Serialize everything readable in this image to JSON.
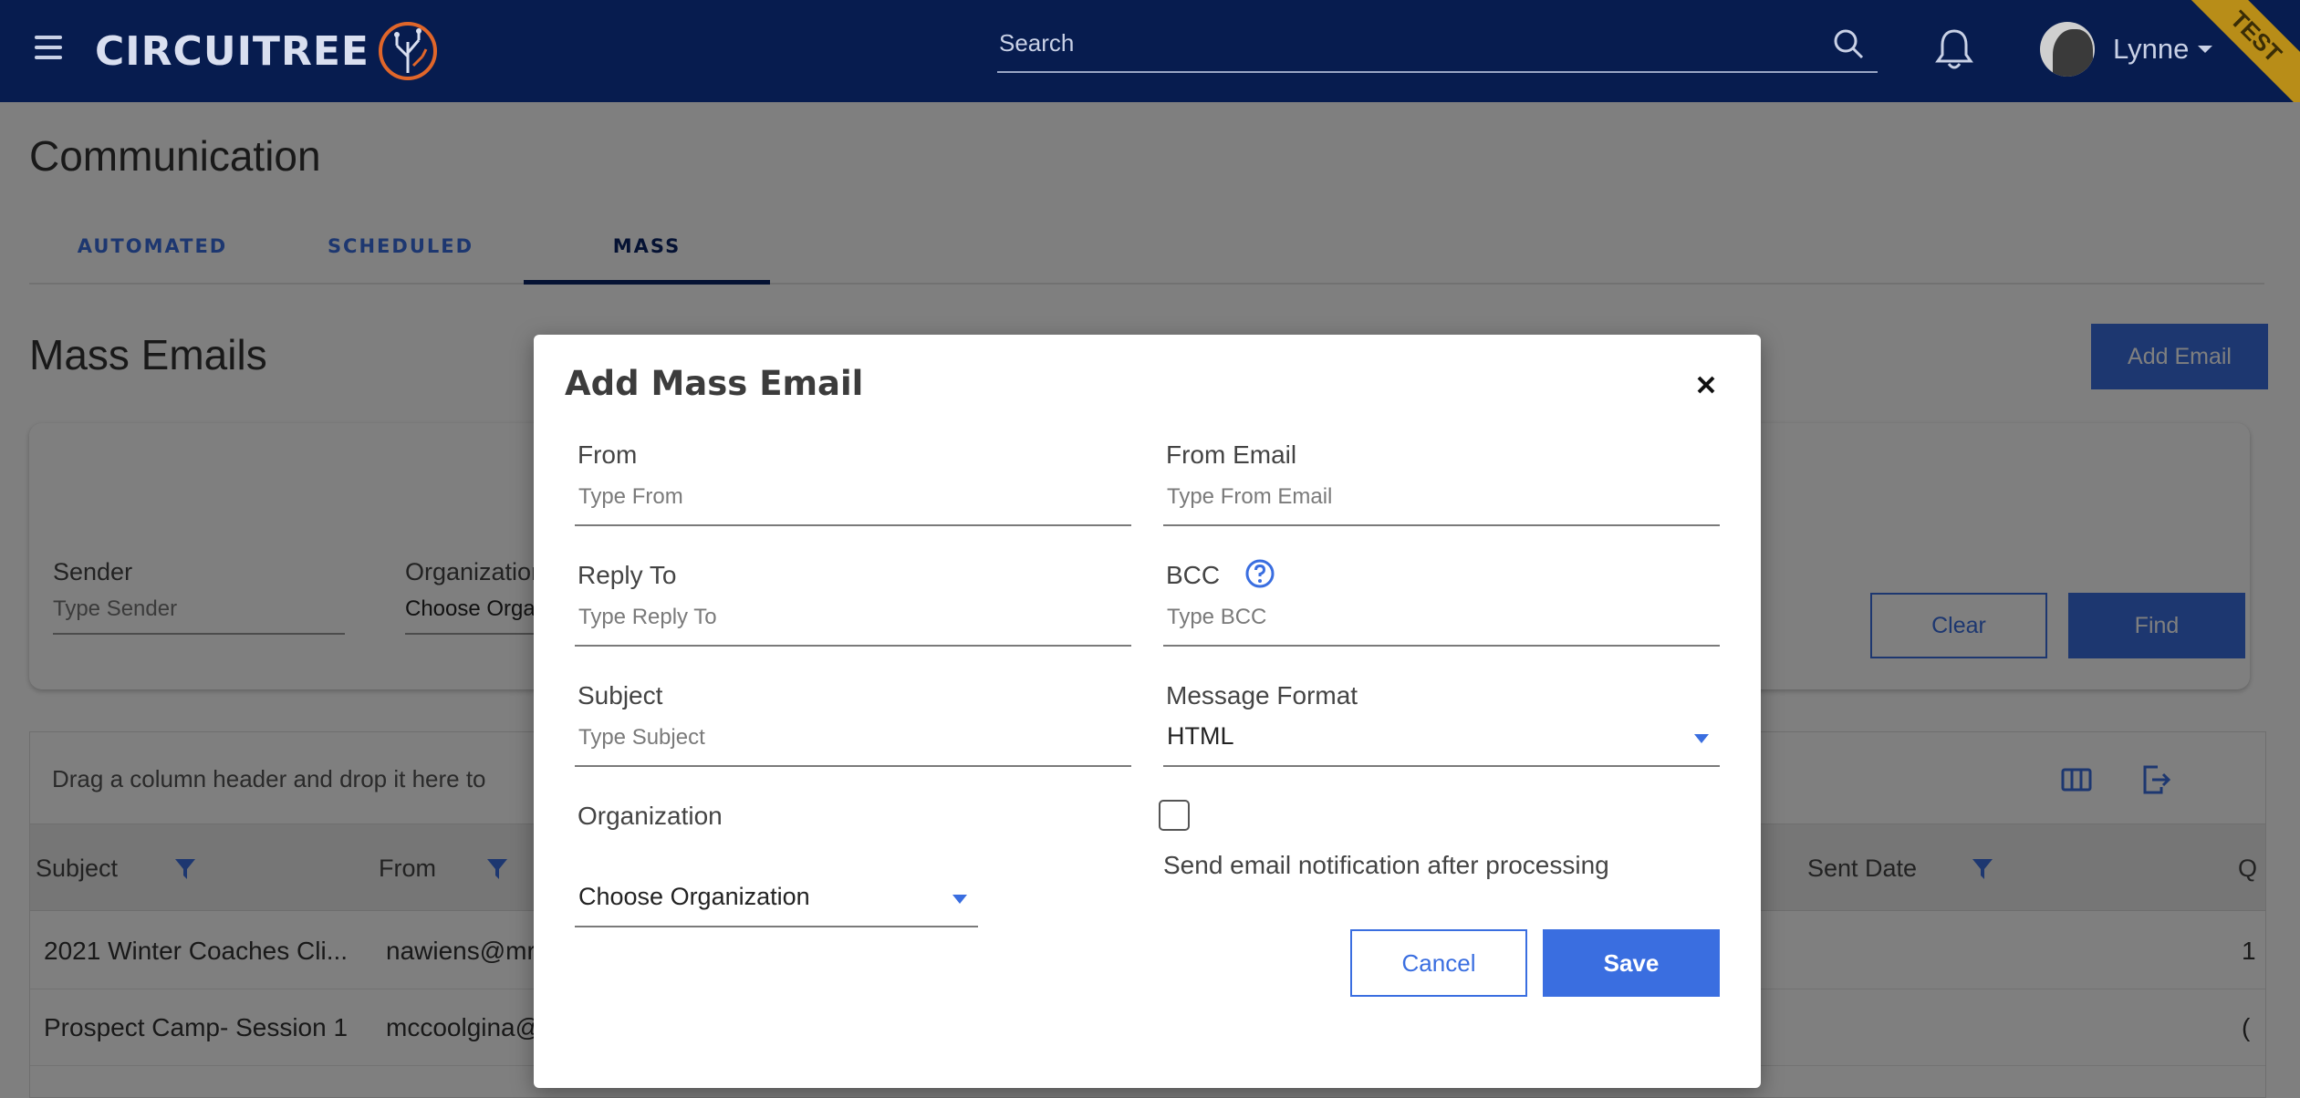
{
  "header": {
    "logo_text": "CIRCUITREE",
    "search_placeholder": "Search",
    "user_name": "Lynne",
    "ribbon_label": "TEST",
    "colors": {
      "bar": "#071c4f",
      "ribbon": "#b88d18"
    },
    "icons": [
      "menu-icon",
      "search-icon",
      "bell-icon",
      "user-caret-icon"
    ]
  },
  "page": {
    "title": "Communication",
    "tabs": [
      {
        "label": "AUTOMATED",
        "active": false
      },
      {
        "label": "SCHEDULED",
        "active": false
      },
      {
        "label": "MASS",
        "active": true
      }
    ],
    "section_title": "Mass Emails",
    "add_email_label": "Add Email"
  },
  "filters": {
    "sender_label": "Sender",
    "sender_placeholder": "Type Sender",
    "organization_label": "Organization",
    "organization_value": "Choose Organization",
    "clear_label": "Clear",
    "find_label": "Find"
  },
  "grid": {
    "drag_hint": "Drag a column header and drop it here to",
    "columns": [
      "Subject",
      "From",
      "Sent Date",
      "Q"
    ],
    "rows": [
      {
        "subject": "2021 Winter Coaches Cli...",
        "from": "nawiens@mr",
        "q": "1"
      },
      {
        "subject": "Prospect Camp- Session 1",
        "from": "mccoolgina@",
        "q": "("
      }
    ]
  },
  "modal": {
    "title": "Add Mass Email",
    "from_label": "From",
    "from_placeholder": "Type From",
    "from_email_label": "From Email",
    "from_email_placeholder": "Type From Email",
    "reply_to_label": "Reply To",
    "reply_to_placeholder": "Type Reply To",
    "bcc_label": "BCC",
    "bcc_placeholder": "Type BCC",
    "subject_label": "Subject",
    "subject_placeholder": "Type Subject",
    "message_format_label": "Message Format",
    "message_format_value": "HTML",
    "organization_label": "Organization",
    "organization_value": "Choose Organization",
    "notify_checked": false,
    "notify_label": "Send email notification after processing",
    "cancel_label": "Cancel",
    "save_label": "Save",
    "accent_color": "#3a6ee0"
  }
}
